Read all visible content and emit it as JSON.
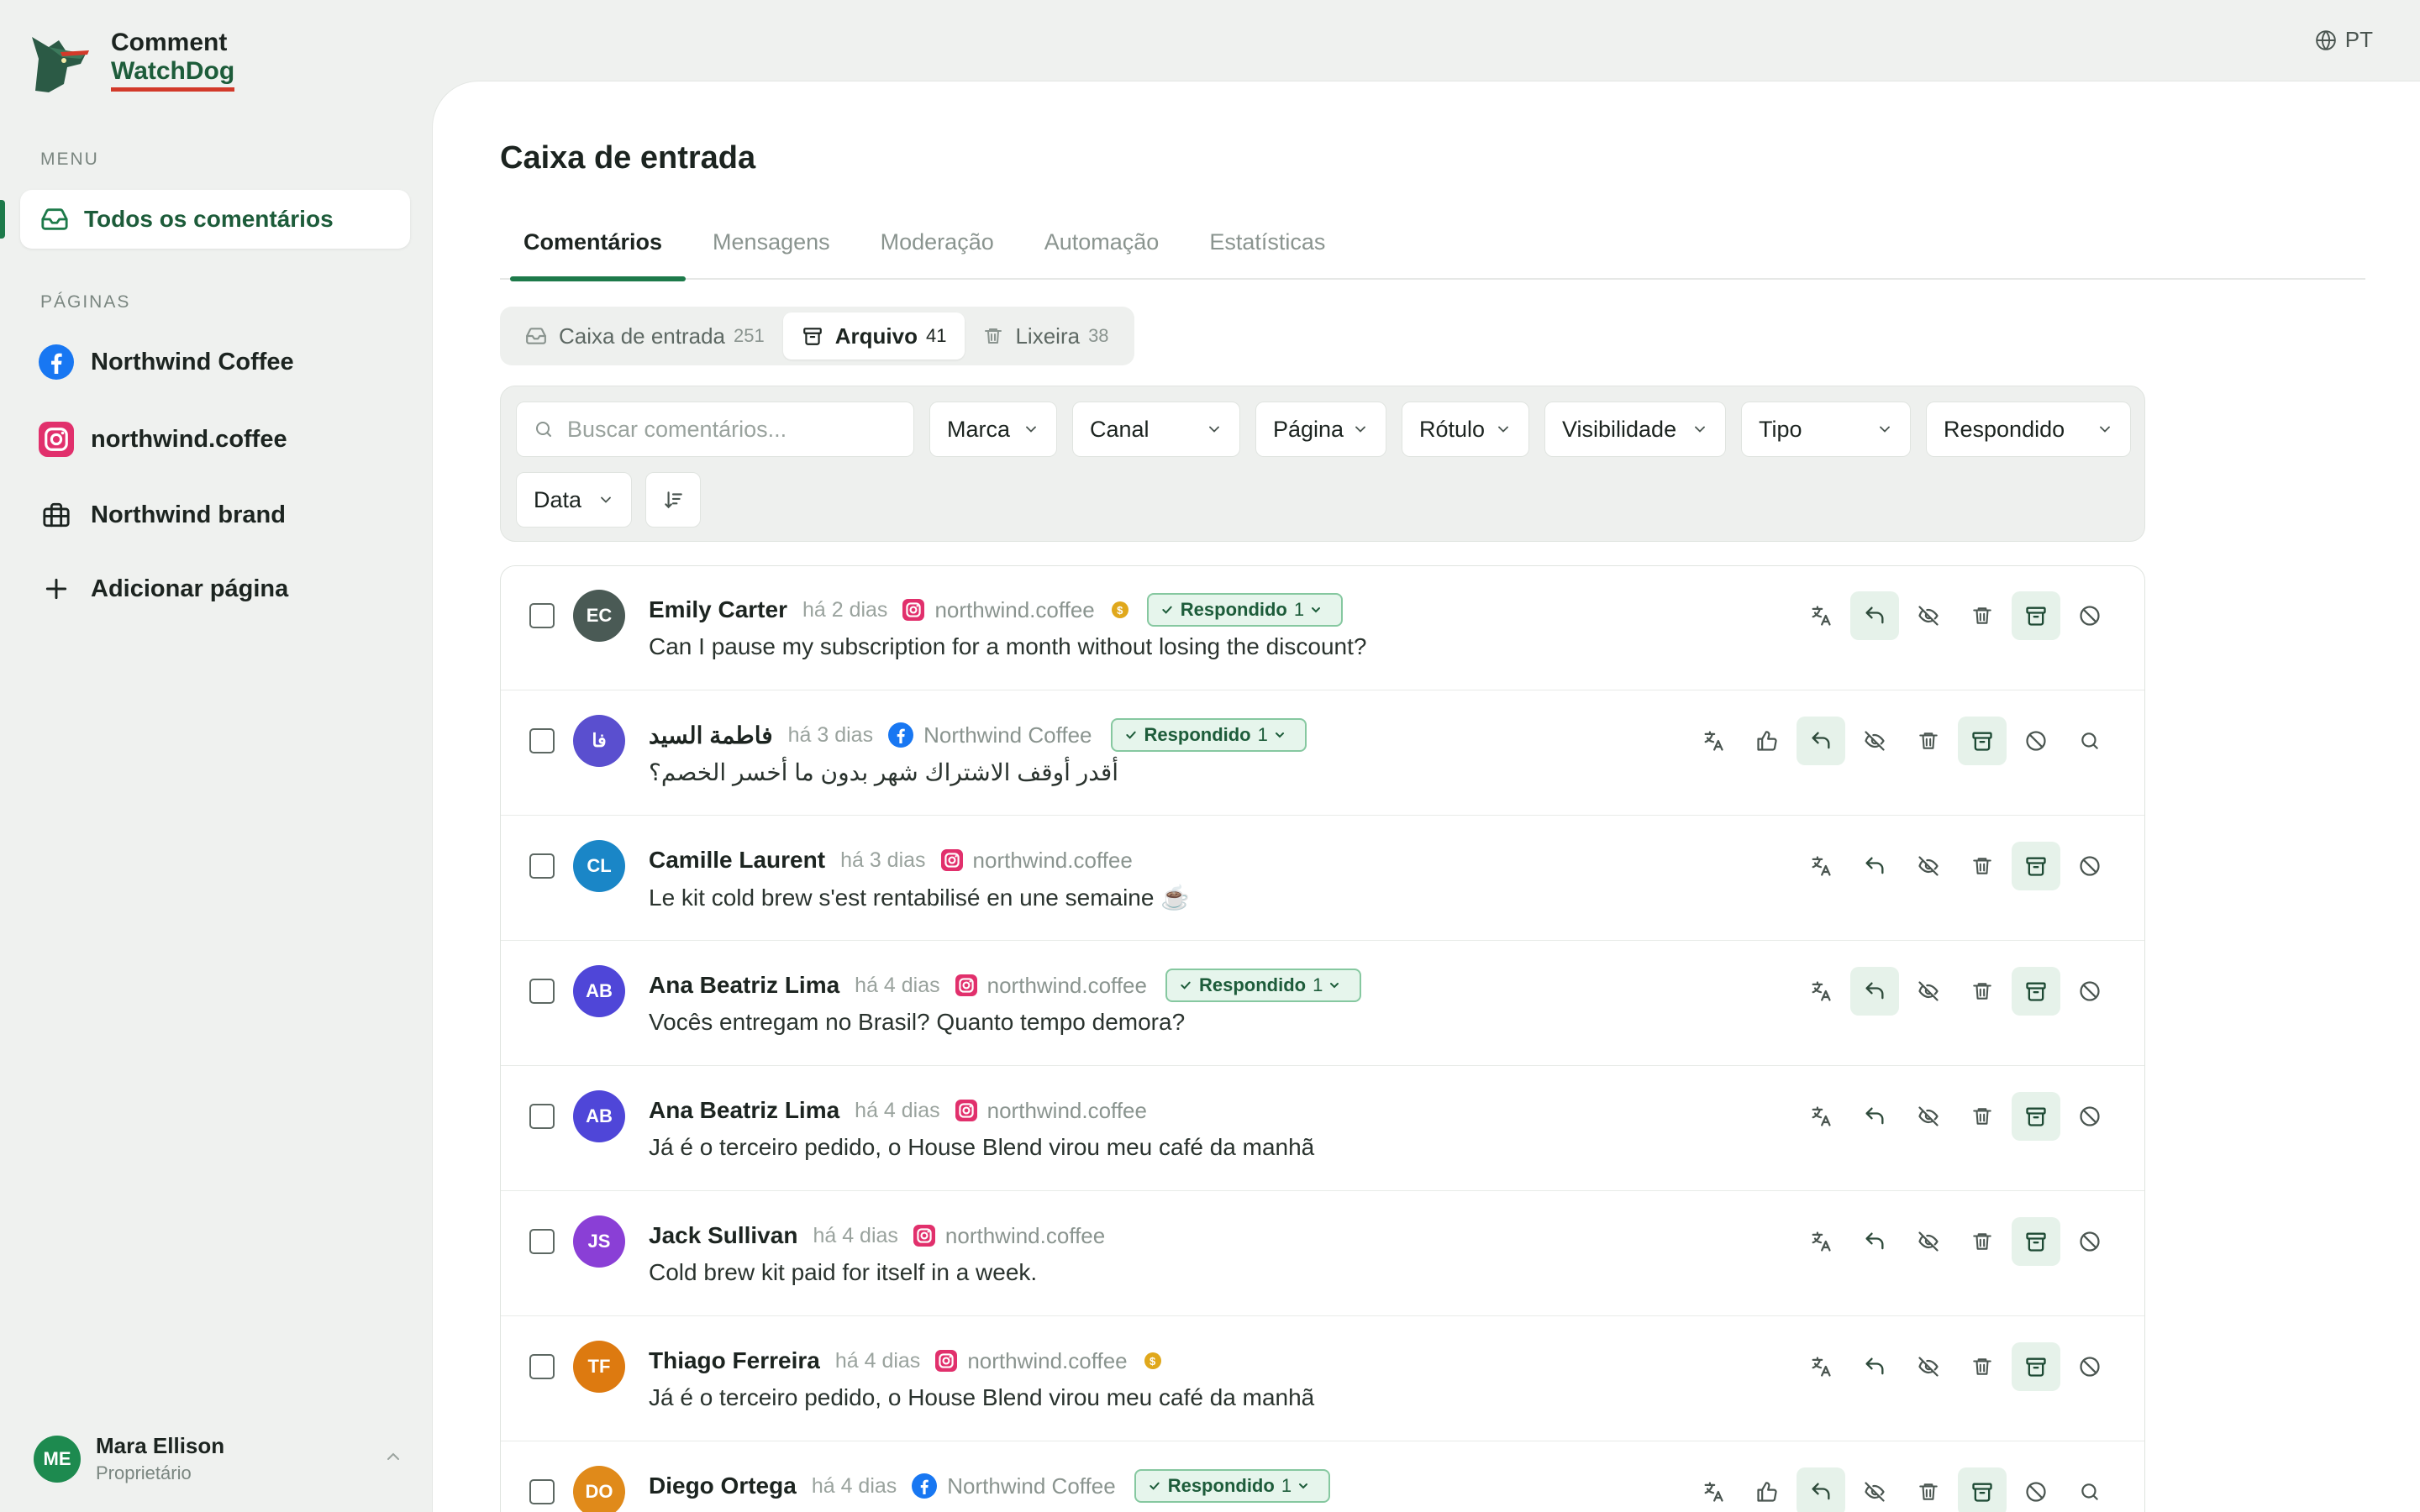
{
  "app": {
    "logo_line1": "Comment",
    "logo_line2": "WatchDog"
  },
  "lang": {
    "code": "PT"
  },
  "sidebar": {
    "menu_label": "MENU",
    "active_item": "Todos os comentários",
    "pages_label": "PÁGINAS",
    "pages": [
      {
        "label": "Northwind Coffee",
        "icon": "facebook-icon"
      },
      {
        "label": "northwind.coffee",
        "icon": "instagram-icon"
      },
      {
        "label": "Northwind brand",
        "icon": "briefcase-icon"
      }
    ],
    "add_page": "Adicionar página",
    "user": {
      "initials": "ME",
      "name": "Mara Ellison",
      "role": "Proprietário"
    }
  },
  "main": {
    "title": "Caixa de entrada",
    "tabs": [
      "Comentários",
      "Mensagens",
      "Moderação",
      "Automação",
      "Estatísticas"
    ],
    "segments": [
      {
        "label": "Caixa de entrada",
        "count": "251"
      },
      {
        "label": "Arquivo",
        "count": "41"
      },
      {
        "label": "Lixeira",
        "count": "38"
      }
    ],
    "search_placeholder": "Buscar comentários...",
    "filters": [
      "Marca",
      "Canal",
      "Página",
      "Rótulo",
      "Visibilidade",
      "Tipo",
      "Respondido",
      "Data"
    ]
  },
  "colors": {
    "accent": "#1d7a4a",
    "instagram": "#e1306c",
    "facebook": "#1877f2"
  },
  "comments": [
    {
      "initials": "EC",
      "author": "Emily Carter",
      "time": "há 2 dias",
      "platform": "instagram",
      "source": "northwind.coffee",
      "coin": true,
      "replied": true,
      "badge": "Respondido",
      "badge_count": "1",
      "text": "Can I pause my subscription for a month without losing the discount?",
      "rtl": false,
      "av_color": "#4a5a55",
      "extended": false
    },
    {
      "initials": "فا",
      "author": "فاطمة السيد",
      "time": "há 3 dias",
      "platform": "facebook",
      "source": "Northwind Coffee",
      "coin": false,
      "replied": true,
      "badge": "Respondido",
      "badge_count": "1",
      "text": "أقدر أوقف الاشتراك شهر بدون ما أخسر الخصم؟",
      "rtl": true,
      "av_color": "#5a4fcf",
      "extended": true
    },
    {
      "initials": "CL",
      "author": "Camille Laurent",
      "time": "há 3 dias",
      "platform": "instagram",
      "source": "northwind.coffee",
      "coin": false,
      "replied": false,
      "text": "Le kit cold brew s'est rentabilisé en une semaine ☕",
      "rtl": false,
      "av_color": "#1a86c7",
      "extended": false
    },
    {
      "initials": "AB",
      "author": "Ana Beatriz Lima",
      "time": "há 4 dias",
      "platform": "instagram",
      "source": "northwind.coffee",
      "coin": false,
      "replied": true,
      "badge": "Respondido",
      "badge_count": "1",
      "text": "Vocês entregam no Brasil? Quanto tempo demora?",
      "rtl": false,
      "av_color": "#4f46d8",
      "extended": false
    },
    {
      "initials": "AB",
      "author": "Ana Beatriz Lima",
      "time": "há 4 dias",
      "platform": "instagram",
      "source": "northwind.coffee",
      "coin": false,
      "replied": false,
      "text": "Já é o terceiro pedido, o House Blend virou meu café da manhã",
      "rtl": false,
      "av_color": "#4f46d8",
      "extended": false
    },
    {
      "initials": "JS",
      "author": "Jack Sullivan",
      "time": "há 4 dias",
      "platform": "instagram",
      "source": "northwind.coffee",
      "coin": false,
      "replied": false,
      "text": "Cold brew kit paid for itself in a week.",
      "rtl": false,
      "av_color": "#8a3fd6",
      "extended": false
    },
    {
      "initials": "TF",
      "author": "Thiago Ferreira",
      "time": "há 4 dias",
      "platform": "instagram",
      "source": "northwind.coffee",
      "coin": true,
      "replied": false,
      "text": "Já é o terceiro pedido, o House Blend virou meu café da manhã",
      "rtl": false,
      "av_color": "#dd7a10",
      "extended": false
    },
    {
      "initials": "DO",
      "author": "Diego Ortega",
      "time": "há 4 dias",
      "platform": "facebook",
      "source": "Northwind Coffee",
      "coin": false,
      "replied": true,
      "badge": "Respondido",
      "badge_count": "1",
      "text": "",
      "rtl": false,
      "av_color": "#e08a1a",
      "extended": true
    }
  ]
}
